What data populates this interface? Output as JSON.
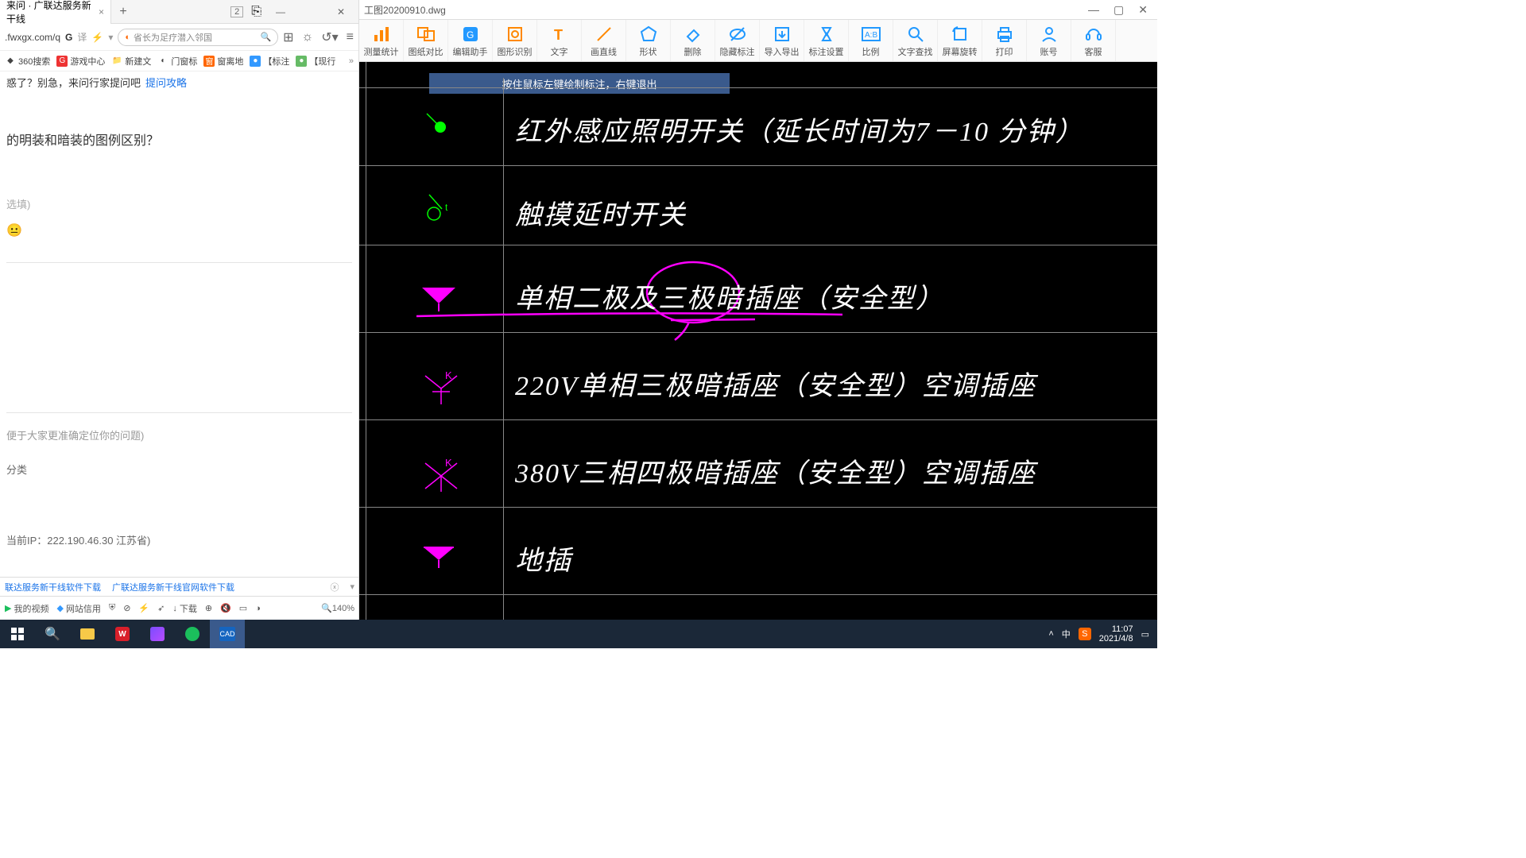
{
  "browser": {
    "tab_title": "来问 · 广联达服务新干线",
    "url": ".fwxgx.com/q",
    "search_placeholder": "省长为足疗潜入邻国",
    "tab_counter": "2",
    "bookmarks": [
      {
        "label": "360搜索"
      },
      {
        "label": "游戏中心"
      },
      {
        "label": "新建文"
      },
      {
        "label": "门窗标"
      },
      {
        "label": "窗离地"
      },
      {
        "label": "【标注"
      },
      {
        "label": "【现行"
      }
    ],
    "prompt_prefix": "惑了？别急，来问行家提问吧",
    "prompt_link": "提问攻略",
    "question": "的明装和暗装的图例区别？",
    "input_placeholder": "选填)",
    "helper": "便于大家更准确定位你的问题)",
    "category": "分类",
    "ip": "当前IP：222.190.46.30 江苏省)",
    "downloads": [
      "联达服务新干线软件下载",
      "广联达服务新干线官网软件下载"
    ],
    "status": {
      "video": "我的视频",
      "credit": "网站信用",
      "download": "下载",
      "zoom": "140%"
    }
  },
  "cad": {
    "filename": "工图20200910.dwg",
    "hint": "按住鼠标左键绘制标注，右键退出",
    "toolbar": [
      {
        "label": "测量统计",
        "icon": "chart"
      },
      {
        "label": "图纸对比",
        "icon": "compare"
      },
      {
        "label": "编辑助手",
        "icon": "edit"
      },
      {
        "label": "图形识别",
        "icon": "recognize"
      },
      {
        "label": "文字",
        "icon": "text"
      },
      {
        "label": "画直线",
        "icon": "line"
      },
      {
        "label": "形状",
        "icon": "shape"
      },
      {
        "label": "删除",
        "icon": "erase"
      },
      {
        "label": "隐藏标注",
        "icon": "hide"
      },
      {
        "label": "导入导出",
        "icon": "io"
      },
      {
        "label": "标注设置",
        "icon": "settings"
      },
      {
        "label": "比例",
        "icon": "ratio"
      },
      {
        "label": "文字查找",
        "icon": "find"
      },
      {
        "label": "屏幕旋转",
        "icon": "rotate"
      },
      {
        "label": "打印",
        "icon": "print"
      },
      {
        "label": "账号",
        "icon": "user"
      },
      {
        "label": "客服",
        "icon": "support"
      }
    ],
    "rows": [
      "红外感应照明开关（延长时间为7－10 分钟）",
      "触摸延时开关",
      "单相二极及三极暗插座（安全型）",
      "220V单相三极暗插座（安全型）空调插座",
      "380V三相四极暗插座（安全型）空调插座",
      "地插"
    ]
  },
  "taskbar": {
    "ime": "中",
    "time": "11:07",
    "date": "2021/4/8"
  }
}
